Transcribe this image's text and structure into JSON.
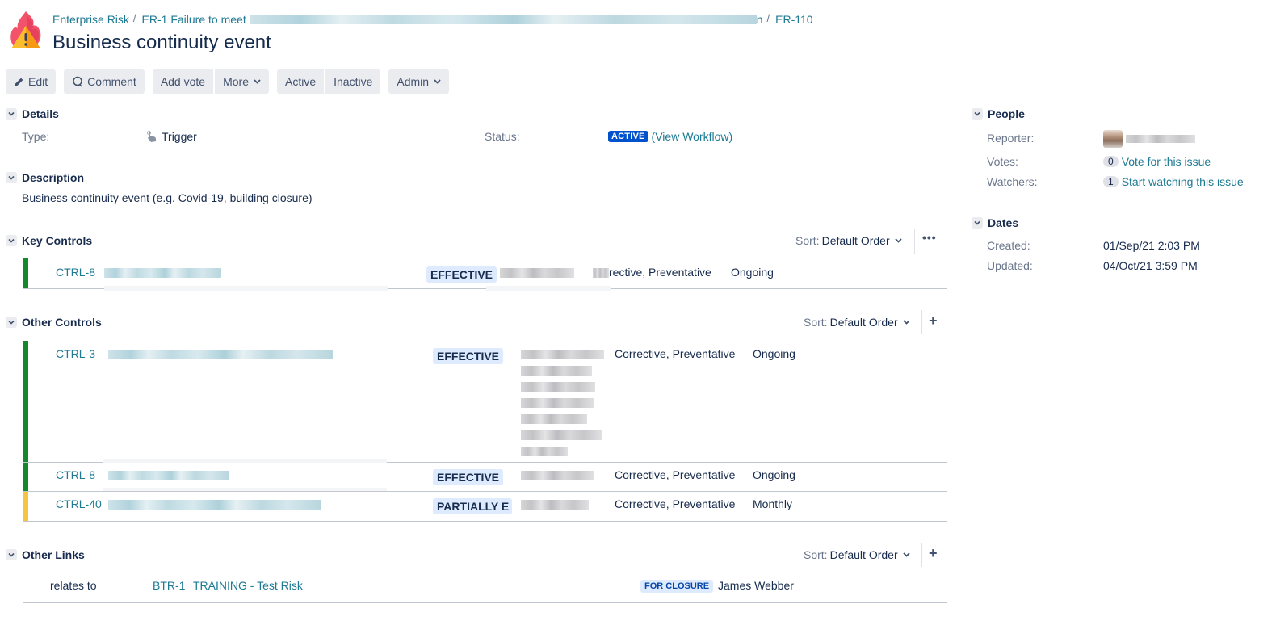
{
  "header": {
    "breadcrumbs": [
      {
        "label": "Enterprise Risk"
      },
      {
        "label": "ER-1 Failure to meet",
        "redacted_suffix": true
      },
      {
        "label": "ER-110"
      }
    ],
    "title": "Business continuity event",
    "project_icon": "fire-warning-icon"
  },
  "toolbar": {
    "edit": "Edit",
    "comment": "Comment",
    "add_vote": "Add vote",
    "more": "More",
    "active": "Active",
    "inactive": "Inactive",
    "admin": "Admin"
  },
  "details": {
    "heading": "Details",
    "type_label": "Type:",
    "type_value": "Trigger",
    "status_label": "Status:",
    "status_value": "ACTIVE",
    "view_workflow": "(View Workflow)"
  },
  "description": {
    "heading": "Description",
    "text": "Business continuity event (e.g. Covid-19, building closure)"
  },
  "key_controls": {
    "heading": "Key Controls",
    "sort_label": "Sort:",
    "sort_value": "Default Order",
    "rows": [
      {
        "key": "CTRL-8",
        "status": "EFFECTIVE",
        "type": "rective, Preventative",
        "frequency": "Ongoing",
        "bar_color": "#14892c"
      }
    ]
  },
  "other_controls": {
    "heading": "Other Controls",
    "sort_label": "Sort:",
    "sort_value": "Default Order",
    "rows": [
      {
        "key": "CTRL-3",
        "status": "EFFECTIVE",
        "type": "Corrective, Preventative",
        "frequency": "Ongoing",
        "bar_color": "#14892c"
      },
      {
        "key": "CTRL-8",
        "status": "EFFECTIVE",
        "type": "Corrective, Preventative",
        "frequency": "Ongoing",
        "bar_color": "#14892c"
      },
      {
        "key": "CTRL-40",
        "status": "PARTIALLY E",
        "type": "Corrective, Preventative",
        "frequency": "Monthly",
        "bar_color": "#f6c342"
      }
    ]
  },
  "other_links": {
    "heading": "Other Links",
    "sort_label": "Sort:",
    "sort_value": "Default Order",
    "rows": [
      {
        "relation": "relates to",
        "key": "BTR-1",
        "summary": "TRAINING - Test Risk",
        "status": "FOR CLOSURE",
        "assignee": "James Webber"
      }
    ]
  },
  "people": {
    "heading": "People",
    "reporter_label": "Reporter:",
    "votes_label": "Votes:",
    "votes_count": "0",
    "vote_link": "Vote for this issue",
    "watchers_label": "Watchers:",
    "watchers_count": "1",
    "watch_link": "Start watching this issue"
  },
  "dates": {
    "heading": "Dates",
    "created_label": "Created:",
    "created_value": "01/Sep/21 2:03 PM",
    "updated_label": "Updated:",
    "updated_value": "04/Oct/21 3:59 PM"
  }
}
